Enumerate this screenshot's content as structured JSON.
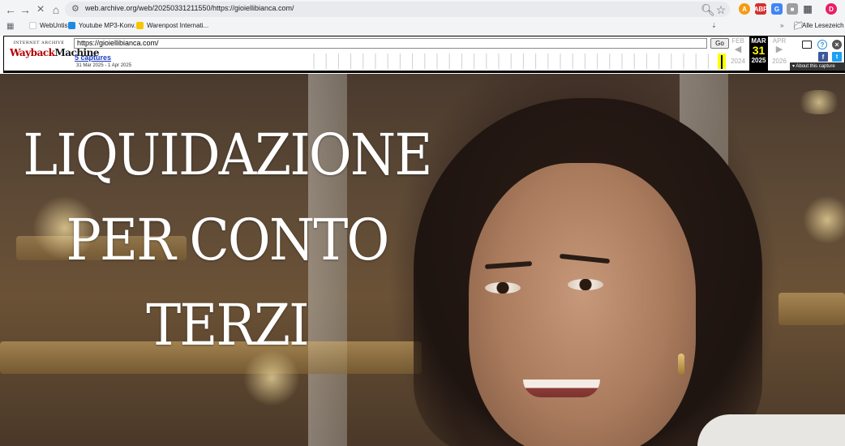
{
  "browser": {
    "url_host": "web.archive.org",
    "url_path": "/web/20250331211550/https://gioiellibianca.com/",
    "profile_initial": "D",
    "bookmarks": [
      {
        "label": "WebUntis",
        "color": "#f2f2f2"
      },
      {
        "label": "Youtube MP3-Konv...",
        "color": "#1e88e5"
      },
      {
        "label": "Warenpost Internati...",
        "color": "#f7c600"
      }
    ],
    "bookmarks_overflow": "»",
    "all_bookmarks_label": "Alle Lesezeich"
  },
  "wayback": {
    "logo_top": "INTERNET ARCHIVE",
    "logo_main_a": "Wayback",
    "logo_main_b": "Machine",
    "url_value": "https://gioiellibianca.com/",
    "go_label": "Go",
    "captures_label": "5 captures",
    "date_range": "31 Mar 2025 - 1 Apr 2025",
    "prev": {
      "month": "FEB",
      "year": "2024"
    },
    "current": {
      "month": "MAR",
      "day": "31",
      "year": "2025"
    },
    "next": {
      "month": "APR",
      "year": "2026"
    },
    "about_label": "About this capture"
  },
  "hero": {
    "headline_lines": [
      "LIQUIDAZIONE",
      "PER CONTO",
      "TERZI"
    ]
  },
  "colors": {
    "wayback_current_bg": "#000000",
    "wayback_current_fg": "#ffff00",
    "captures_link": "#1a3cc2"
  }
}
